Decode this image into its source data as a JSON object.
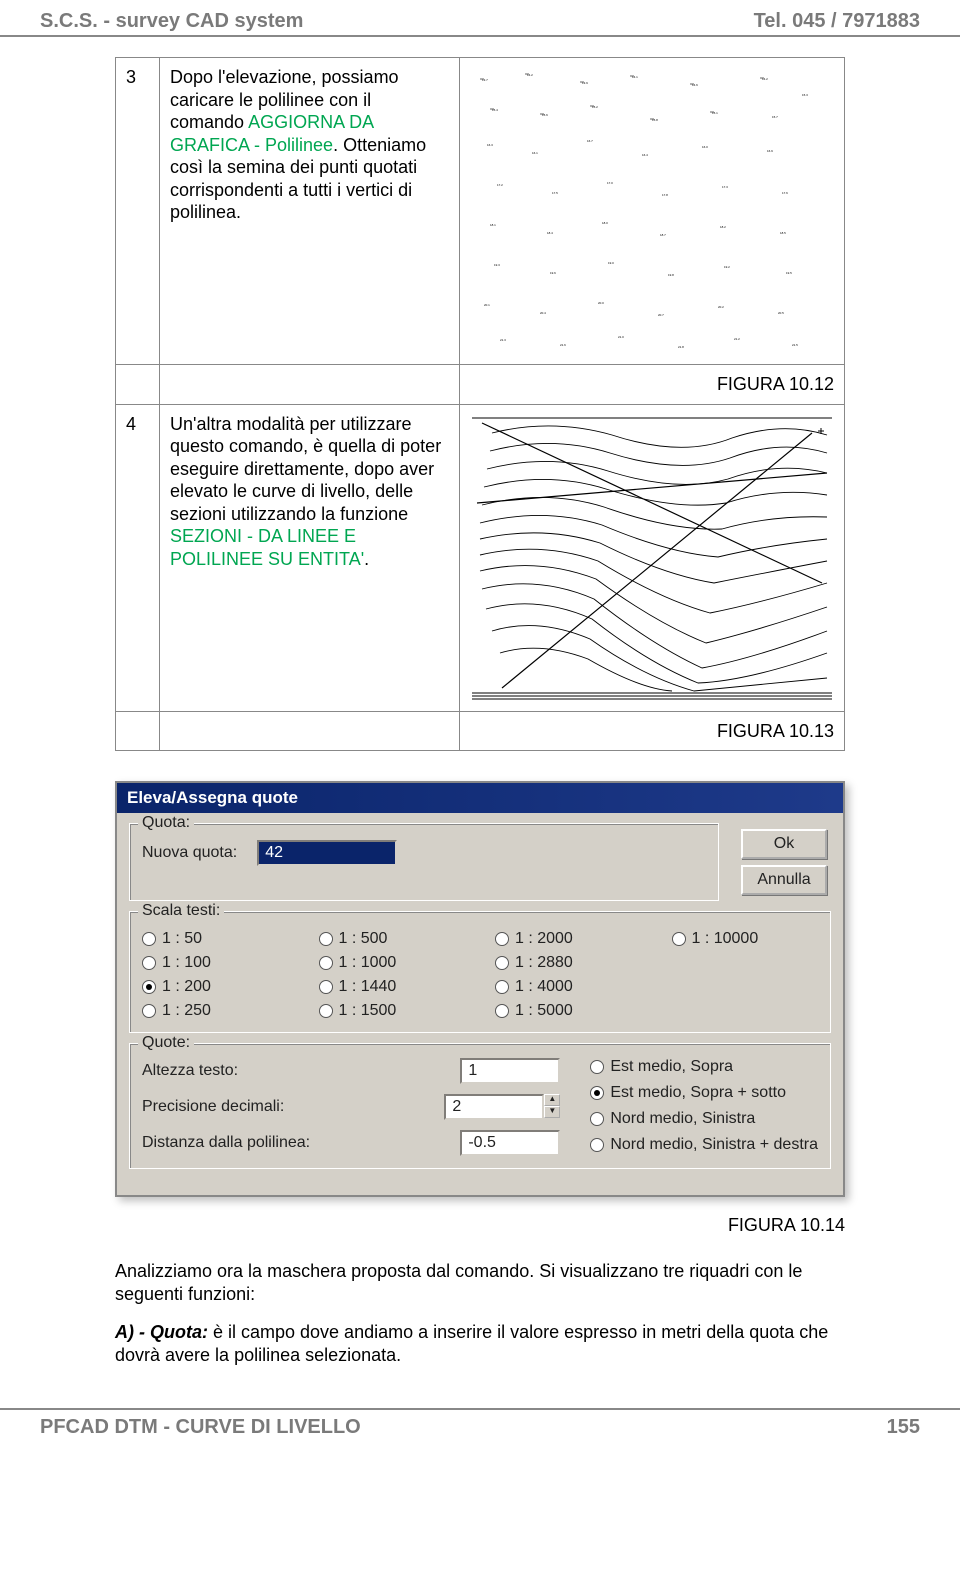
{
  "header": {
    "left": "S.C.S. - survey CAD system",
    "right": "Tel. 045 / 7971883"
  },
  "footer": {
    "left": "PFCAD  DTM - CURVE DI LIVELLO",
    "right": "155"
  },
  "table": {
    "row3": {
      "num": "3",
      "pre": "Dopo l'elevazione, possiamo caricare le polilinee con il comando ",
      "cmd": "AGGIORNA DA GRAFICA - Polilinee",
      "post": ". Otteniamo così la semina dei punti quotati corrispondenti a tutti i vertici di polilinea.",
      "caption": "FIGURA 10.12"
    },
    "row4": {
      "num": "4",
      "pre": "Un'altra modalità per utilizzare questo comando, è quella di poter eseguire direttamente, dopo aver elevato le curve di livello, delle sezioni utilizzando la funzione ",
      "cmd": "SEZIONI - DA LINEE E POLILINEE SU ENTITA'",
      "post": ".",
      "caption": "FIGURA 10.13"
    }
  },
  "dialog": {
    "title": "Eleva/Assegna quote",
    "buttons": {
      "ok": "Ok",
      "cancel": "Annulla"
    },
    "quota": {
      "legend": "Quota:",
      "label": "Nuova quota:",
      "value": "42"
    },
    "scala": {
      "legend": "Scala testi:",
      "options": [
        {
          "label": "1 : 50",
          "selected": false
        },
        {
          "label": "1 : 500",
          "selected": false
        },
        {
          "label": "1 : 2000",
          "selected": false
        },
        {
          "label": "1 : 10000",
          "selected": false
        },
        {
          "label": "1 : 100",
          "selected": false
        },
        {
          "label": "1 : 1000",
          "selected": false
        },
        {
          "label": "1 : 2880",
          "selected": false
        },
        {
          "label": "",
          "selected": false
        },
        {
          "label": "1 : 200",
          "selected": true
        },
        {
          "label": "1 : 1440",
          "selected": false
        },
        {
          "label": "1 : 4000",
          "selected": false
        },
        {
          "label": "",
          "selected": false
        },
        {
          "label": "1 : 250",
          "selected": false
        },
        {
          "label": "1 : 1500",
          "selected": false
        },
        {
          "label": "1 : 5000",
          "selected": false
        },
        {
          "label": "",
          "selected": false
        }
      ]
    },
    "quote": {
      "legend": "Quote:",
      "altezza_label": "Altezza testo:",
      "altezza_val": "1",
      "prec_label": "Precisione decimali:",
      "prec_val": "2",
      "dist_label": "Distanza dalla polilinea:",
      "dist_val": "-0.5",
      "position": [
        {
          "label": "Est medio, Sopra",
          "selected": false
        },
        {
          "label": "Est medio, Sopra + sotto",
          "selected": true
        },
        {
          "label": "Nord medio, Sinistra",
          "selected": false
        },
        {
          "label": "Nord medio, Sinistra + destra",
          "selected": false
        }
      ]
    }
  },
  "fig14": "FIGURA  10.14",
  "body": {
    "p1": "Analizziamo ora la maschera proposta dal comando. Si visualizzano tre riquadri con le seguenti funzioni:",
    "p2_lead": "A) - Quota:",
    "p2_rest": " è il campo dove andiamo a inserire il valore espresso in metri della quota che dovrà avere la polilinea selezionata."
  }
}
